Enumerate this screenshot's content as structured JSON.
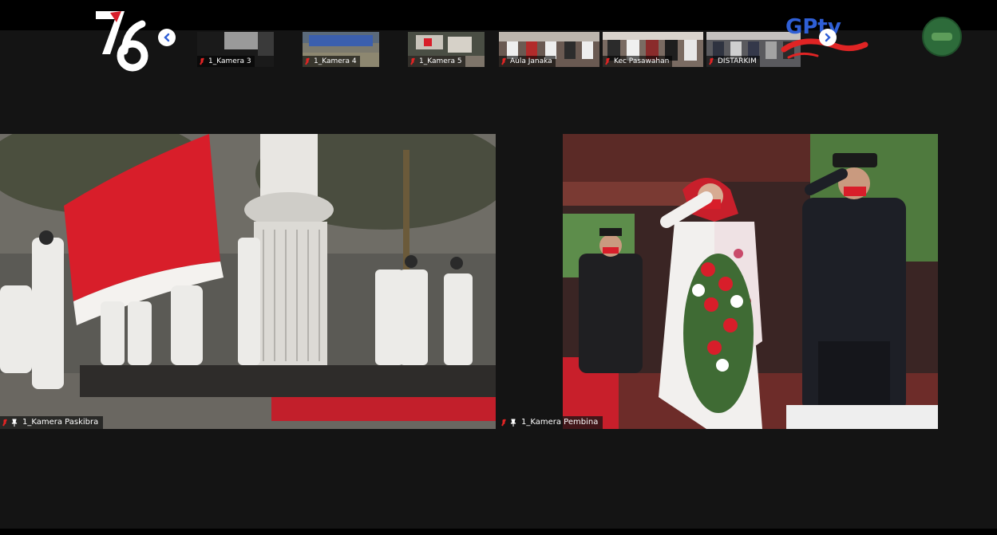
{
  "branding": {
    "anniversary_logo": "76",
    "channel_logo": "GPtv",
    "partner_logo": "circle-emblem"
  },
  "nav": {
    "prev_icon": "‹",
    "next_icon": "›"
  },
  "thumbnails": [
    {
      "label": "1_Kamera 3",
      "muted": true
    },
    {
      "label": "1_Kamera 4",
      "muted": true
    },
    {
      "label": "1_Kamera 5",
      "muted": true
    },
    {
      "label": "Aula Janaka",
      "muted": true
    },
    {
      "label": "Kec Pasawahan",
      "muted": true
    },
    {
      "label": "DISTARKIM",
      "muted": true
    }
  ],
  "main_tiles": [
    {
      "label": "1_Kamera Paskibra",
      "muted": true,
      "pinned": true
    },
    {
      "label": "1_Kamera Pembina",
      "muted": true,
      "pinned": true
    }
  ],
  "colors": {
    "background": "#111111",
    "topbar": "#000000",
    "mute_red": "#e02424",
    "flag_red": "#d81e2a",
    "accent_blue": "#2f5fd6"
  }
}
